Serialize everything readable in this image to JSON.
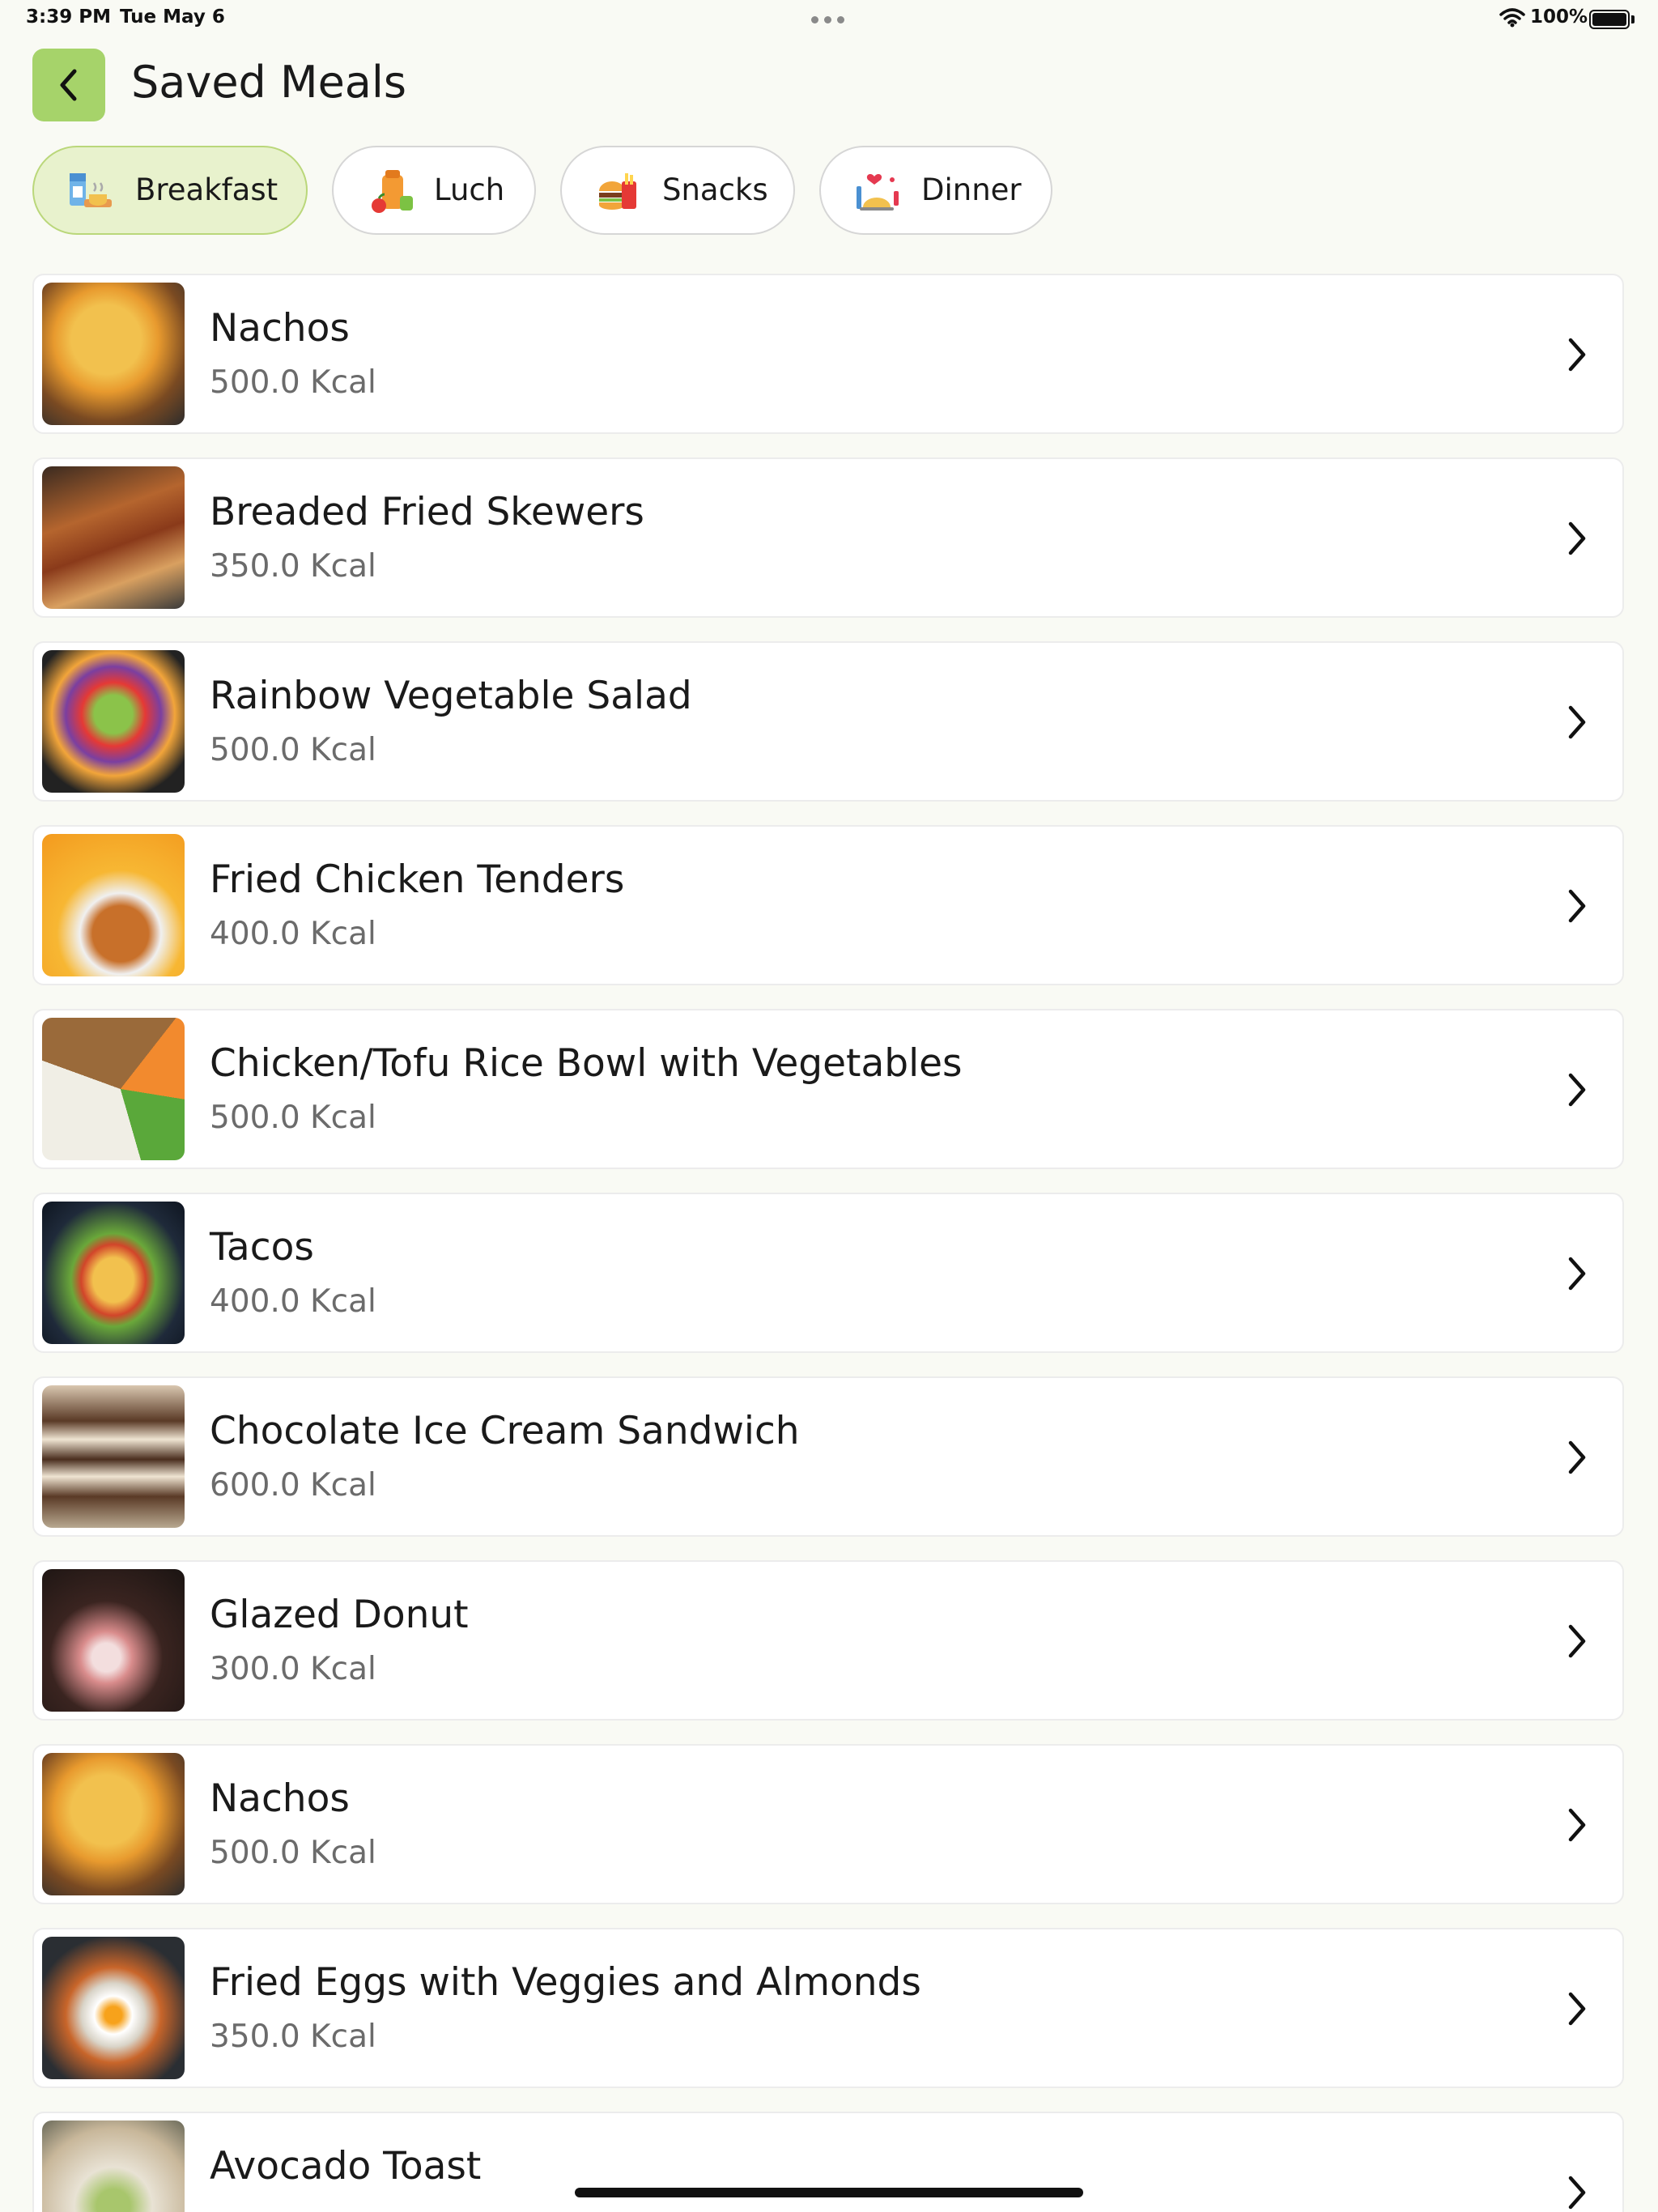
{
  "status_bar": {
    "time": "3:39 PM",
    "date": "Tue May 6",
    "battery": "100%"
  },
  "header": {
    "back_icon": "chevron-left-icon",
    "title": "Saved Meals"
  },
  "tabs": [
    {
      "label": "Breakfast",
      "icon": "breakfast-icon",
      "active": true
    },
    {
      "label": "Luch",
      "icon": "lunch-icon",
      "active": false
    },
    {
      "label": "Snacks",
      "icon": "snacks-icon",
      "active": false
    },
    {
      "label": "Dinner",
      "icon": "dinner-icon",
      "active": false
    }
  ],
  "meals": [
    {
      "name": "Nachos",
      "kcal": "500.0 Kcal"
    },
    {
      "name": "Breaded Fried Skewers",
      "kcal": "350.0 Kcal"
    },
    {
      "name": "Rainbow Vegetable Salad",
      "kcal": "500.0 Kcal"
    },
    {
      "name": "Fried Chicken Tenders",
      "kcal": "400.0 Kcal"
    },
    {
      "name": "Chicken/Tofu Rice Bowl with Vegetables",
      "kcal": "500.0 Kcal"
    },
    {
      "name": "Tacos",
      "kcal": "400.0 Kcal"
    },
    {
      "name": "Chocolate Ice Cream Sandwich",
      "kcal": "600.0 Kcal"
    },
    {
      "name": "Glazed Donut",
      "kcal": "300.0 Kcal"
    },
    {
      "name": "Nachos",
      "kcal": "500.0 Kcal"
    },
    {
      "name": "Fried Eggs with Veggies and Almonds",
      "kcal": "350.0 Kcal"
    },
    {
      "name": "Avocado Toast",
      "kcal": ""
    }
  ],
  "colors": {
    "accent": "#a6d36a",
    "active_tab_bg": "#e8f2cd",
    "background": "#f9faf4"
  }
}
